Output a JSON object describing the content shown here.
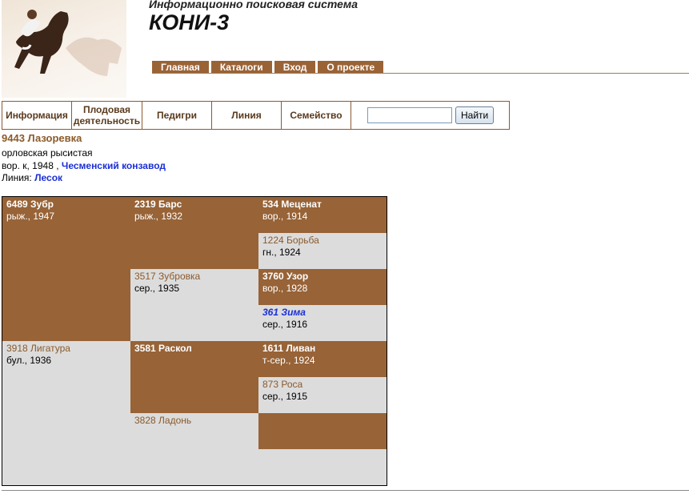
{
  "header": {
    "subtitle": "Информационно поисковая система",
    "title": "КОНИ-3"
  },
  "topnav": [
    "Главная",
    "Каталоги",
    "Вход",
    "О проекте"
  ],
  "tabs": [
    "Информация",
    "Плодовая деятельность",
    "Педигри",
    "Линия",
    "Семейство"
  ],
  "search": {
    "value": "",
    "button": "Найти"
  },
  "horse": {
    "name": "9443 Лазоревка",
    "breed": "орловская рысистая",
    "details_prefix": "вор. к, 1948 ,",
    "stud_link": "Чесменский конзавод",
    "line_label": "Линия:",
    "line_link": "Лесок"
  },
  "pedigree": {
    "sire": {
      "name": "6489 Зубр",
      "info": "рыж., 1947"
    },
    "dam": {
      "name": "3918 Лигатура",
      "info": "бул., 1936"
    },
    "sire_sire": {
      "name": "2319 Барс",
      "info": "рыж., 1932"
    },
    "sire_dam": {
      "name": "3517 Зубровка",
      "info": "сер., 1935"
    },
    "dam_sire": {
      "name": "3581 Раскол",
      "info": ""
    },
    "dam_dam": {
      "name": "3828 Ладонь",
      "info": ""
    },
    "g3": [
      {
        "name": "534 Меценат",
        "info": "вор., 1914"
      },
      {
        "name": "1224 Борьба",
        "info": "гн., 1924"
      },
      {
        "name": "3760 Узор",
        "info": "вор., 1928"
      },
      {
        "name": "361 Зима",
        "info": "сер., 1916"
      },
      {
        "name": "1611 Ливан",
        "info": "т-сер., 1924"
      },
      {
        "name": "873 Роса",
        "info": "сер., 1915"
      },
      {
        "name": "",
        "info": ""
      }
    ]
  }
}
